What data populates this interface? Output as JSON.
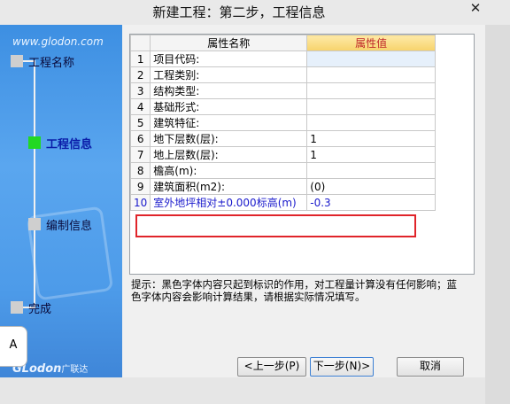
{
  "window": {
    "title": "新建工程：第二步，工程信息",
    "close_glyph": "✕"
  },
  "sidebar": {
    "url": "www.glodon.com",
    "steps": [
      {
        "label": "工程名称"
      },
      {
        "label": "工程信息"
      },
      {
        "label": "编制信息"
      },
      {
        "label": "完成"
      }
    ],
    "brand": "GLodon",
    "brand_suffix": "广联达",
    "tab_letter": "A"
  },
  "table": {
    "headers": {
      "name": "属性名称",
      "value": "属性值"
    },
    "rows": [
      {
        "num": "1",
        "name": "项目代码:",
        "value": ""
      },
      {
        "num": "2",
        "name": "工程类别:",
        "value": ""
      },
      {
        "num": "3",
        "name": "结构类型:",
        "value": ""
      },
      {
        "num": "4",
        "name": "基础形式:",
        "value": ""
      },
      {
        "num": "5",
        "name": "建筑特征:",
        "value": ""
      },
      {
        "num": "6",
        "name": "地下层数(层):",
        "value": "1"
      },
      {
        "num": "7",
        "name": "地上层数(层):",
        "value": "1"
      },
      {
        "num": "8",
        "name": "檐高(m):",
        "value": ""
      },
      {
        "num": "9",
        "name": "建筑面积(m2):",
        "value": "(0)"
      },
      {
        "num": "10",
        "name": "室外地坪相对±0.000标高(m)",
        "value": "-0.3"
      }
    ]
  },
  "hint": "提示：黑色字体内容只起到标识的作用，对工程量计算没有任何影响；蓝色字体内容会影响计算结果，请根据实际情况填写。",
  "buttons": {
    "prev": "<上一步(P)",
    "next": "下一步(N)>",
    "cancel": "取消"
  }
}
